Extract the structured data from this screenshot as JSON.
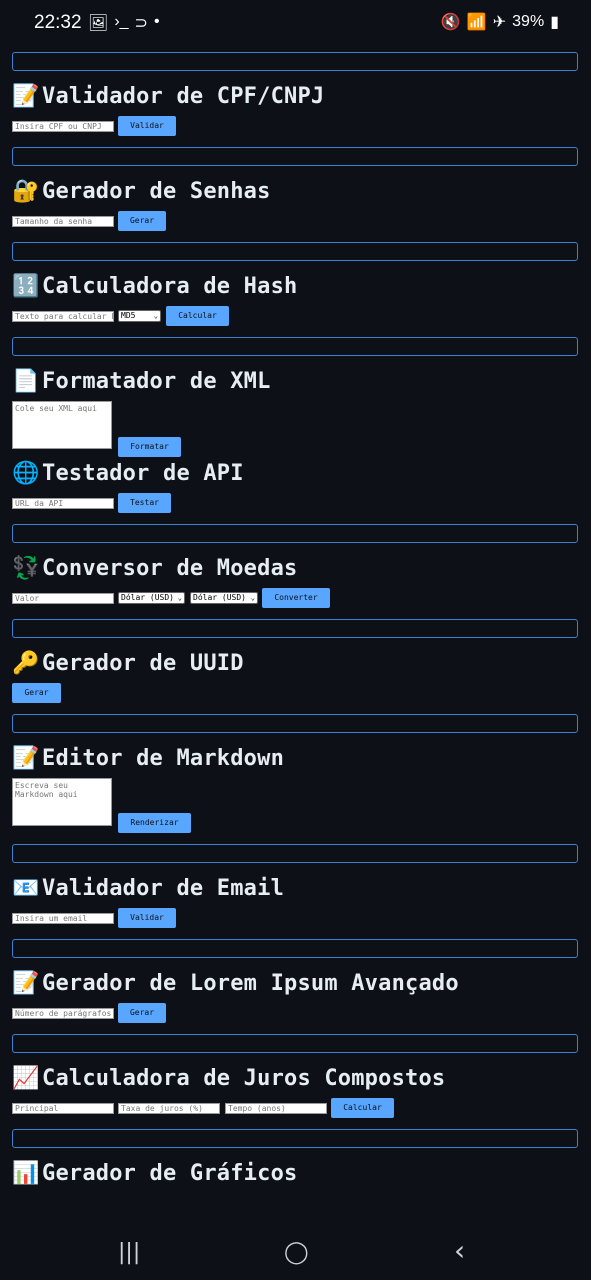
{
  "status_bar": {
    "time": "22:32",
    "left_icons": [
      "image-icon",
      "terminal-icon",
      "hook-icon",
      "dot-icon"
    ],
    "battery": "39%",
    "right_icons": [
      "mute-icon",
      "wifi-icon",
      "airplane-icon",
      "battery-icon"
    ]
  },
  "tools": {
    "cpf": {
      "emoji": "📝",
      "title": "Validador de CPF/CNPJ",
      "input_placeholder": "Insira CPF ou CNPJ",
      "button": "Validar"
    },
    "senhas": {
      "emoji": "🔐",
      "title": "Gerador de Senhas",
      "input_placeholder": "Tamanho da senha",
      "button": "Gerar"
    },
    "hash": {
      "emoji": "🔢",
      "title": "Calculadora de Hash",
      "input_placeholder": "Texto para calcular hash",
      "select_value": "MD5",
      "button": "Calcular"
    },
    "xml": {
      "emoji": "📄",
      "title": "Formatador de XML",
      "textarea_placeholder": "Cole seu XML aqui",
      "button": "Formatar"
    },
    "api": {
      "emoji": "🌐",
      "title": "Testador de API",
      "input_placeholder": "URL da API",
      "button": "Testar"
    },
    "moedas": {
      "emoji": "💱",
      "title": "Conversor de Moedas",
      "input_placeholder": "Valor",
      "select_from": "Dólar (USD)",
      "select_to": "Dólar (USD)",
      "button": "Converter"
    },
    "uuid": {
      "emoji": "🔑",
      "title": "Gerador de UUID",
      "button": "Gerar"
    },
    "markdown": {
      "emoji": "📝",
      "title": "Editor de Markdown",
      "textarea_placeholder": "Escreva seu Markdown aqui",
      "button": "Renderizar"
    },
    "email": {
      "emoji": "📧",
      "title": "Validador de Email",
      "input_placeholder": "Insira um email",
      "button": "Validar"
    },
    "lorem": {
      "emoji": "📝",
      "title": "Gerador de Lorem Ipsum Avançado",
      "input_placeholder": "Número de parágrafos",
      "button": "Gerar"
    },
    "juros": {
      "emoji": "📈",
      "title": "Calculadora de Juros Compostos",
      "principal_placeholder": "Principal",
      "taxa_placeholder": "Taxa de juros (%)",
      "tempo_placeholder": "Tempo (anos)",
      "button": "Calcular"
    },
    "graficos": {
      "emoji": "📊",
      "title": "Gerador de Gráficos"
    }
  },
  "nav_bar": {
    "recents": "|||",
    "home": "◯",
    "back": "‹"
  }
}
